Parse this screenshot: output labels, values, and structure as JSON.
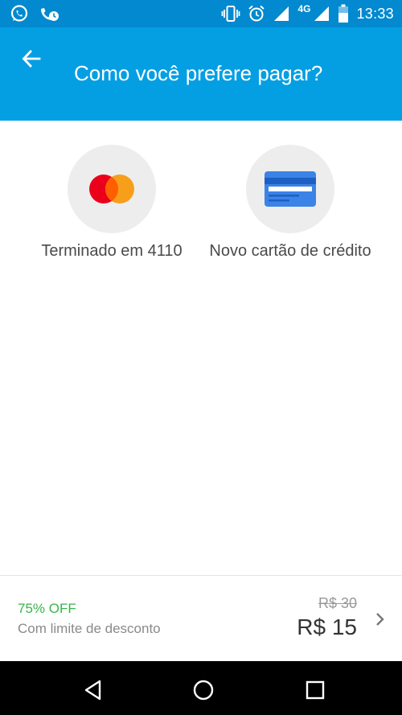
{
  "status_bar": {
    "network": "4G",
    "time": "13:33",
    "icons": [
      "whatsapp-icon",
      "missed-call-icon",
      "vibrate-icon",
      "alarm-icon",
      "signal-icon",
      "signal-icon",
      "battery-icon"
    ]
  },
  "header": {
    "title": "Como você prefere pagar?",
    "back_icon": "arrow-back-icon"
  },
  "payment_options": [
    {
      "label": "Terminado em 4110",
      "icon": "mastercard-icon"
    },
    {
      "label": "Novo cartão de crédito",
      "icon": "credit-card-icon"
    }
  ],
  "summary": {
    "discount": "75% OFF",
    "discount_note": "Com limite de desconto",
    "original_price": "R$ 30",
    "final_price": "R$ 15"
  },
  "colors": {
    "app_bar": "#049fe3",
    "status_bar": "#0289cf",
    "discount": "#39b54a",
    "card_blue": "#3b83e6",
    "mastercard_red": "#eb001b",
    "mastercard_orange": "#f79e1b"
  }
}
